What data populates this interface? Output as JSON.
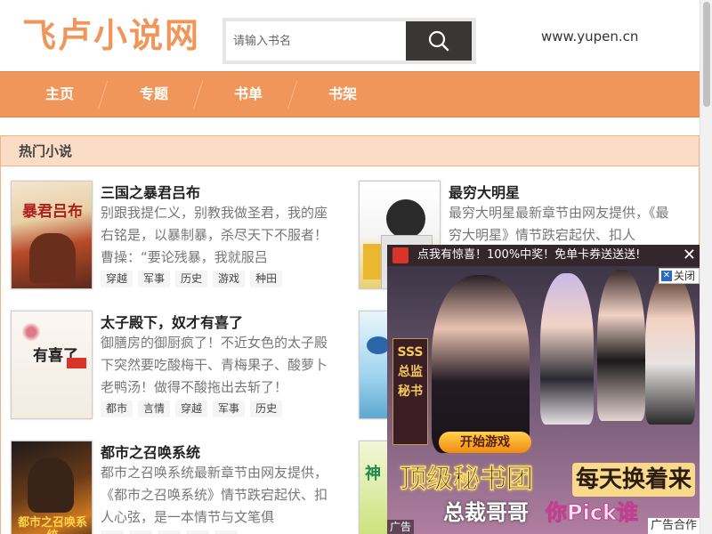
{
  "header": {
    "logo": "飞卢小说网",
    "search_placeholder": "请输入书名",
    "site_url": "www.yupen.cn"
  },
  "nav": {
    "items": [
      {
        "label": "主页"
      },
      {
        "label": "专题"
      },
      {
        "label": "书单"
      },
      {
        "label": "书架"
      }
    ]
  },
  "hot": {
    "title": "热门小说",
    "books": [
      {
        "title": "三国之暴君吕布",
        "desc": "别跟我提仁义，别教我做圣君，我的座右铭是，以暴制暴，杀尽天下不服者！曹操：“要论残暴，我就服吕",
        "tags": [
          "穿越",
          "军事",
          "历史",
          "游戏",
          "种田"
        ],
        "cover_text": "暴君吕布"
      },
      {
        "title": "最穷大明星",
        "desc": "最穷大明星最新章节由网友提供，《最穷大明星》情节跌宕起伏、扣人",
        "tags": [],
        "cover_text": ""
      },
      {
        "title": "太子殿下，奴才有喜了",
        "desc": "御膳房的御厨疯了！不近女色的太子殿下突然要吃酸梅干、青梅果子、酸萝卜老鸭汤！做得不酸拖出去斩了！",
        "tags": [
          "都市",
          "言情",
          "穿越",
          "军事",
          "历史"
        ],
        "cover_text": "有喜了"
      },
      {
        "title": "都市之召唤系统",
        "desc": "都市之召唤系统最新章节由网友提供，《都市之召唤系统》情节跌宕起伏、扣人心弦，是一本情节与文笔俱",
        "tags": [],
        "cover_text": "都市之召唤系统"
      }
    ]
  },
  "ad": {
    "top_text": "点我有惊喜！100%中奖！免单卡券送送送!",
    "close_x": "✕",
    "close_label": "关闭",
    "sss_text": "SSS总监秘书",
    "start_button": "开始游戏",
    "banner_left": "顶级秘书团",
    "banner_right": "每天换着来",
    "sub_left": "总裁哥哥",
    "sub_right": "你Pick谁",
    "ad_label": "广告",
    "coop_label": "广告合作"
  },
  "colors": {
    "accent": "#f0965a",
    "nav_bg": "#f0965a",
    "section_header_bg": "#fbdcc4",
    "search_button": "#3a3633"
  }
}
